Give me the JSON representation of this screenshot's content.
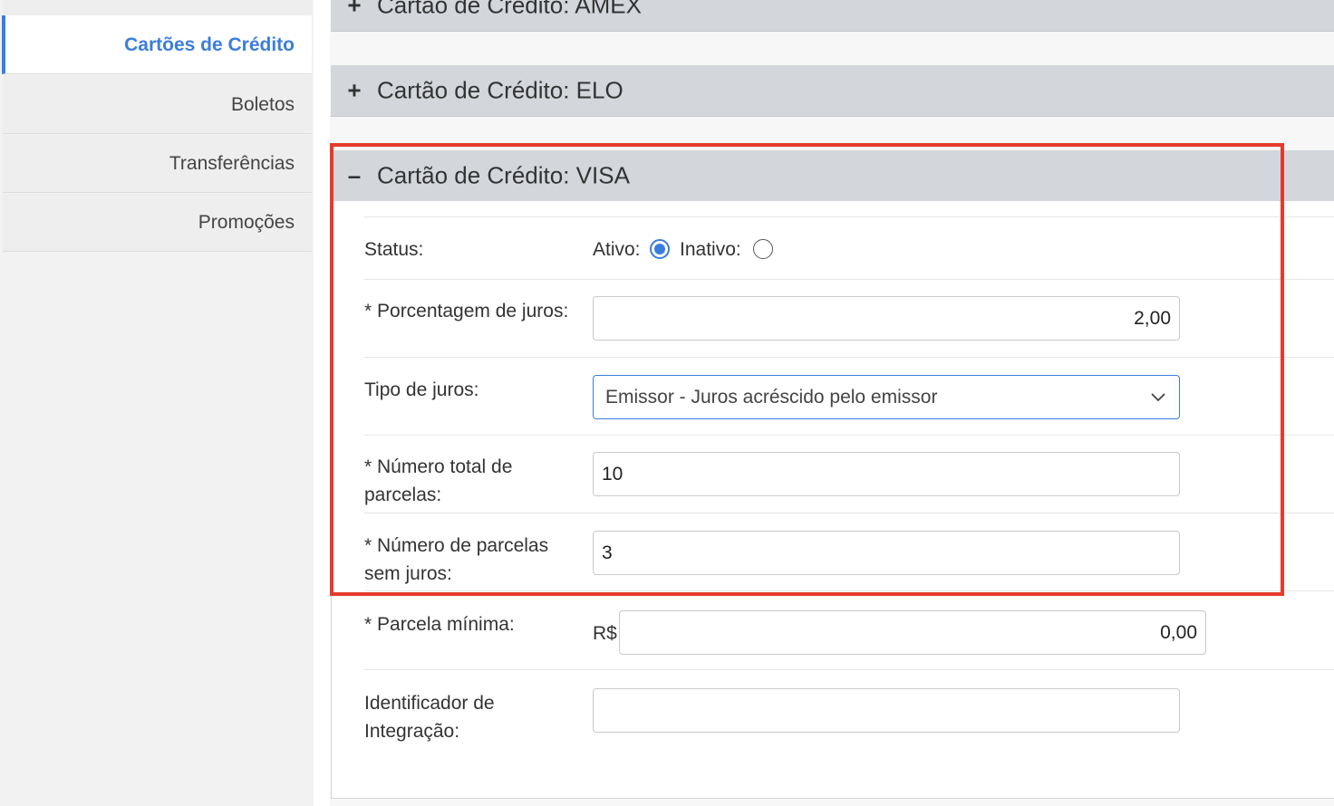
{
  "sidebar": {
    "items": [
      {
        "label": "Cartões de Crédito",
        "active": true
      },
      {
        "label": "Boletos"
      },
      {
        "label": "Transferências"
      },
      {
        "label": "Promoções"
      }
    ]
  },
  "accordions": {
    "amex": {
      "sign": "+",
      "title": "Cartão de Crédito: AMEX"
    },
    "elo": {
      "sign": "+",
      "title": "Cartão de Crédito: ELO"
    },
    "visa": {
      "sign": "–",
      "title": "Cartão de Crédito: VISA"
    }
  },
  "form": {
    "status": {
      "label": "Status:",
      "active_label": "Ativo:",
      "inactive_label": "Inativo:",
      "value": "Ativo"
    },
    "porcentagem": {
      "label": "* Porcentagem de juros:",
      "value": "2,00"
    },
    "tipo": {
      "label": "Tipo de juros:",
      "value": "Emissor - Juros acréscido pelo emissor"
    },
    "total_parcelas": {
      "label": "* Número total de parcelas:",
      "value": "10"
    },
    "sem_juros": {
      "label": "* Número de parcelas sem juros:",
      "value": "3"
    },
    "parcela_minima": {
      "label": "* Parcela mínima:",
      "currency": "R$",
      "value": "0,00"
    },
    "identificador": {
      "label": "Identificador de Integração:",
      "value": ""
    }
  },
  "colors": {
    "accent": "#3b7ddd",
    "highlight": "#e53b2c",
    "header_bg": "#d3d7dc"
  }
}
